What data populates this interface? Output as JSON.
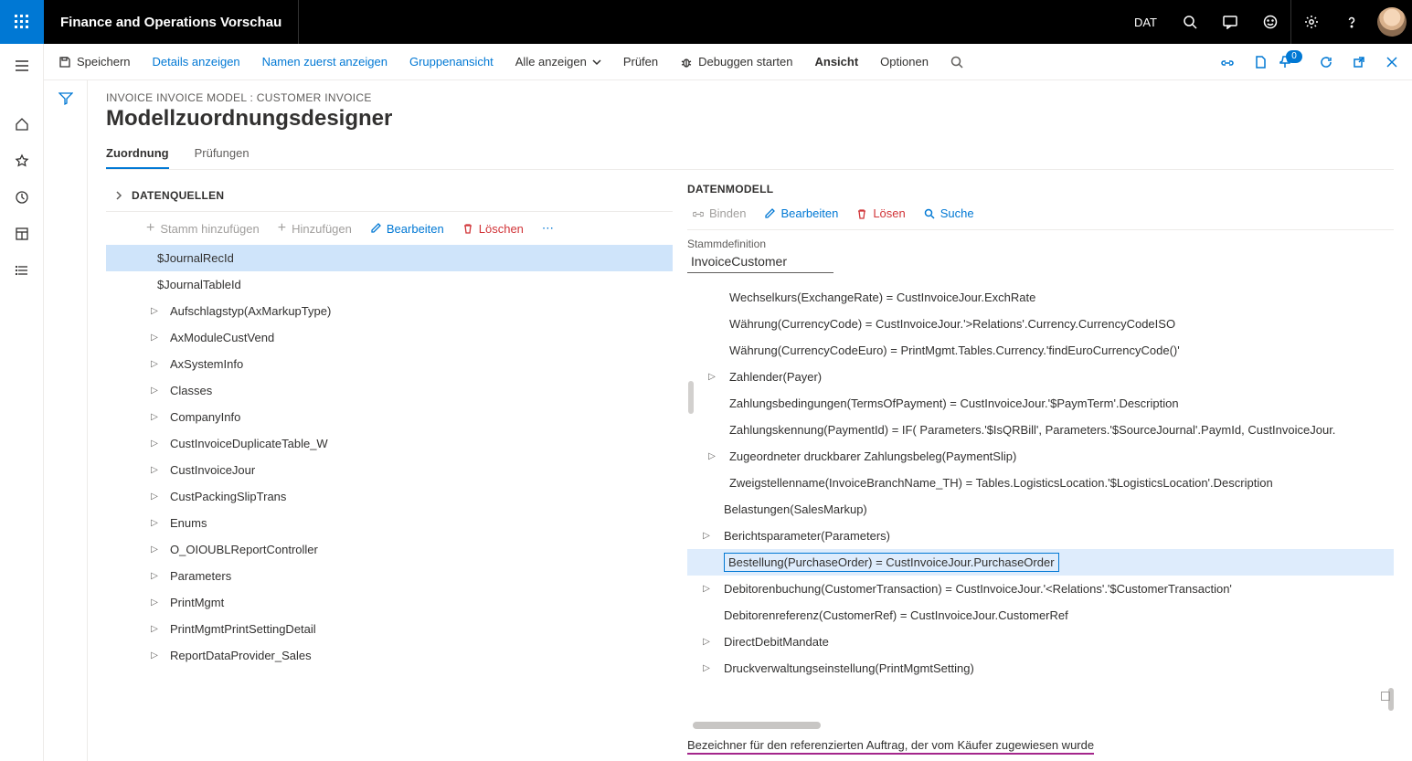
{
  "topbar": {
    "app_title": "Finance and Operations Vorschau",
    "legal_entity": "DAT"
  },
  "cmdbar": {
    "save": "Speichern",
    "details": "Details anzeigen",
    "names_first": "Namen zuerst anzeigen",
    "group_view": "Gruppenansicht",
    "show_all": "Alle anzeigen",
    "check": "Prüfen",
    "debug_start": "Debuggen starten",
    "view": "Ansicht",
    "options": "Optionen",
    "badge_count": "0"
  },
  "page": {
    "breadcrumb": "INVOICE INVOICE MODEL : CUSTOMER INVOICE",
    "title": "Modellzuordnungsdesigner"
  },
  "tabs": {
    "mapping": "Zuordnung",
    "validations": "Prüfungen"
  },
  "datasources": {
    "title": "DATENQUELLEN",
    "toolbar": {
      "add_root": "Stamm hinzufügen",
      "add": "Hinzufügen",
      "edit": "Bearbeiten",
      "delete": "Löschen"
    },
    "items": [
      {
        "label": "$JournalRecId",
        "caret": false,
        "selected": true
      },
      {
        "label": "$JournalTableId",
        "caret": false
      },
      {
        "label": "Aufschlagstyp(AxMarkupType)",
        "caret": true
      },
      {
        "label": "AxModuleCustVend",
        "caret": true
      },
      {
        "label": "AxSystemInfo",
        "caret": true
      },
      {
        "label": "Classes",
        "caret": true
      },
      {
        "label": "CompanyInfo",
        "caret": true
      },
      {
        "label": "CustInvoiceDuplicateTable_W",
        "caret": true
      },
      {
        "label": "CustInvoiceJour",
        "caret": true
      },
      {
        "label": "CustPackingSlipTrans",
        "caret": true
      },
      {
        "label": "Enums",
        "caret": true
      },
      {
        "label": "O_OIOUBLReportController",
        "caret": true
      },
      {
        "label": "Parameters",
        "caret": true
      },
      {
        "label": "PrintMgmt",
        "caret": true
      },
      {
        "label": "PrintMgmtPrintSettingDetail",
        "caret": true
      },
      {
        "label": "ReportDataProvider_Sales",
        "caret": true
      }
    ]
  },
  "datamodel": {
    "title": "DATENMODELL",
    "toolbar": {
      "bind": "Binden",
      "edit": "Bearbeiten",
      "unbind": "Lösen",
      "search": "Suche"
    },
    "rootdef_label": "Stammdefinition",
    "rootdef_value": "InvoiceCustomer",
    "items": [
      {
        "label": "Wechselkurs(ExchangeRate) = CustInvoiceJour.ExchRate",
        "caret": false
      },
      {
        "label": "Währung(CurrencyCode) = CustInvoiceJour.'>Relations'.Currency.CurrencyCodeISO",
        "caret": false
      },
      {
        "label": "Währung(CurrencyCodeEuro) = PrintMgmt.Tables.Currency.'findEuroCurrencyCode()'",
        "caret": false
      },
      {
        "label": "Zahlender(Payer)",
        "caret": true
      },
      {
        "label": "Zahlungsbedingungen(TermsOfPayment) = CustInvoiceJour.'$PaymTerm'.Description",
        "caret": false
      },
      {
        "label": "Zahlungskennung(PaymentId) = IF( Parameters.'$IsQRBill', Parameters.'$SourceJournal'.PaymId, CustInvoiceJour.",
        "caret": false
      },
      {
        "label": "Zugeordneter druckbarer Zahlungsbeleg(PaymentSlip)",
        "caret": true
      },
      {
        "label": "Zweigstellenname(InvoiceBranchName_TH) = Tables.LogisticsLocation.'$LogisticsLocation'.Description",
        "caret": false
      },
      {
        "label": "Belastungen(SalesMarkup)",
        "caret": false,
        "indent": 1
      },
      {
        "label": "Berichtsparameter(Parameters)",
        "caret": true,
        "indent": 1
      },
      {
        "label": "Bestellung(PurchaseOrder) = CustInvoiceJour.PurchaseOrder",
        "caret": false,
        "indent": 1,
        "selected": true
      },
      {
        "label": "Debitorenbuchung(CustomerTransaction) = CustInvoiceJour.'<Relations'.'$CustomerTransaction'",
        "caret": true,
        "indent": 1
      },
      {
        "label": "Debitorenreferenz(CustomerRef) = CustInvoiceJour.CustomerRef",
        "caret": false,
        "indent": 1
      },
      {
        "label": "DirectDebitMandate",
        "caret": true,
        "indent": 1
      },
      {
        "label": "Druckverwaltungseinstellung(PrintMgmtSetting)",
        "caret": true,
        "indent": 1
      }
    ],
    "hint": "Bezeichner für den referenzierten Auftrag, der vom Käufer zugewiesen wurde"
  }
}
